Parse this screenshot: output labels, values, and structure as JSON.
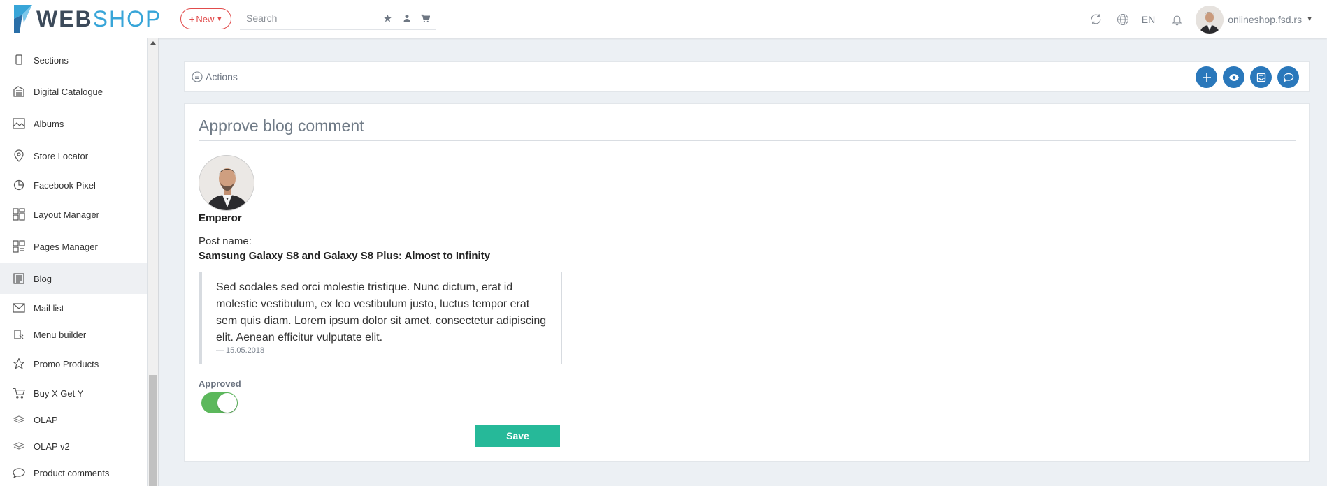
{
  "header": {
    "logo": {
      "part1": "WEB",
      "part2": "SHOP"
    },
    "new_button": {
      "plus": "+",
      "label": "New"
    },
    "search": {
      "placeholder": "Search"
    },
    "language": "EN",
    "user": {
      "name": "onlineshop.fsd.rs"
    }
  },
  "sidebar": {
    "items": [
      {
        "label": "Sections",
        "icon": "tablet-icon"
      },
      {
        "label": "Digital Catalogue",
        "icon": "catalogue-icon"
      },
      {
        "label": "Albums",
        "icon": "image-icon"
      },
      {
        "label": "Store Locator",
        "icon": "map-pin-icon"
      },
      {
        "label": "Facebook Pixel",
        "icon": "pie-chart-icon"
      },
      {
        "label": "Layout Manager",
        "icon": "layout-icon"
      },
      {
        "label": "Pages Manager",
        "icon": "pages-icon"
      },
      {
        "label": "Blog",
        "icon": "blog-icon",
        "active": true
      },
      {
        "label": "Mail list",
        "icon": "envelope-icon"
      },
      {
        "label": "Menu builder",
        "icon": "menu-builder-icon"
      },
      {
        "label": "Promo Products",
        "icon": "star-outline-icon"
      },
      {
        "label": "Buy X Get Y",
        "icon": "cart-icon"
      },
      {
        "label": "OLAP",
        "icon": "layers-icon"
      },
      {
        "label": "OLAP v2",
        "icon": "layers-icon"
      },
      {
        "label": "Product comments",
        "icon": "comment-icon"
      }
    ]
  },
  "actions": {
    "label": "Actions"
  },
  "form": {
    "title": "Approve blog comment",
    "author": "Emperor",
    "post_label": "Post name:",
    "post_name": "Samsung Galaxy S8 and Galaxy S8 Plus: Almost to Infinity",
    "comment_text": "Sed sodales sed orci molestie tristique. Nunc dictum, erat id molestie vestibulum, ex leo vestibulum justo, luctus tempor erat sem quis diam. Lorem ipsum dolor sit amet, consectetur adipiscing elit. Aenean efficitur vulputate elit.",
    "comment_date": "— 15.05.2018",
    "approved_label": "Approved",
    "approved": true,
    "save_label": "Save"
  },
  "colors": {
    "brand_dark": "#3c4a5a",
    "brand_accent": "#38a5d8",
    "new_button": "#e14c4c",
    "action_button": "#2a78bb",
    "toggle_on": "#5cb85c",
    "save_button": "#26b999"
  }
}
